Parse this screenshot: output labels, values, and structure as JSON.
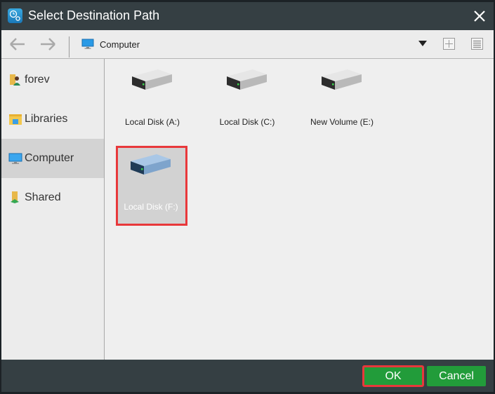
{
  "window": {
    "title": "Select Destination Path",
    "app_icon": "backup-clock-gear-icon",
    "close_icon": "close-icon"
  },
  "toolbar": {
    "back_icon": "arrow-left-icon",
    "forward_icon": "arrow-right-icon",
    "location_icon": "computer-monitor-icon",
    "current_path": "Computer",
    "dropdown_icon": "triangle-down-icon",
    "new_folder_icon": "plus-box-icon",
    "view_icon": "list-view-icon"
  },
  "sidebar": {
    "items": [
      {
        "label": "forev",
        "icon": "user-folder-icon",
        "selected": false
      },
      {
        "label": "Libraries",
        "icon": "libraries-folder-icon",
        "selected": false
      },
      {
        "label": "Computer",
        "icon": "computer-monitor-icon",
        "selected": true
      },
      {
        "label": "Shared",
        "icon": "shared-folder-icon",
        "selected": false
      }
    ]
  },
  "drives": [
    {
      "label": "Local Disk (A:)",
      "icon": "hard-drive-icon",
      "selected": false
    },
    {
      "label": "Local Disk (C:)",
      "icon": "hard-drive-icon",
      "selected": false
    },
    {
      "label": "New Volume (E:)",
      "icon": "hard-drive-icon",
      "selected": false
    },
    {
      "label": "Local Disk (F:)",
      "icon": "hard-drive-icon",
      "selected": true
    }
  ],
  "footer": {
    "ok_label": "OK",
    "cancel_label": "Cancel"
  },
  "colors": {
    "chrome": "#353f43",
    "button_green": "#229c3a",
    "highlight_red": "#e8383b",
    "selection_gray": "#d3d3d3"
  }
}
